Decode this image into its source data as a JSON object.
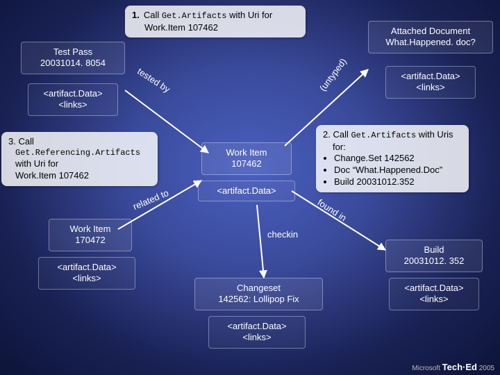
{
  "callouts": {
    "c1": {
      "num": "1.",
      "pre": "Call ",
      "code": "Get.Artifacts",
      "post": " with Uri for",
      "line2": "Work.Item 107462"
    },
    "c2": {
      "line1": "2. Call ",
      "code1": "Get.Artifacts",
      "line1b": " with Uris",
      "line2": "for:",
      "b1": "Change.Set 142562",
      "b2": "Doc “What.Happened.Doc”",
      "b3": "Build 20031012.352"
    },
    "c3": {
      "line1": "3. Call",
      "code": "Get.Referencing.Artifacts",
      "line2": "with Uri for",
      "line3": "Work.Item 107462"
    }
  },
  "nodes": {
    "testpass": {
      "l1": "Test Pass",
      "l2": "20031014. 8054"
    },
    "tp_art": {
      "l1": "<artifact.Data>",
      "l2": "<links>"
    },
    "wi107462": {
      "l1": "Work Item",
      "l2": "107462"
    },
    "wi_art": {
      "l1": "<artifact.Data>"
    },
    "doc": {
      "l1": "Attached Document",
      "l2": "What.Happened. doc?"
    },
    "doc_art": {
      "l1": "<artifact.Data>",
      "l2": "<links>"
    },
    "checkin": {
      "l1": "checkin"
    },
    "changeset": {
      "l1": "Changeset",
      "l2": "142562: Lollipop Fix"
    },
    "cs_art": {
      "l1": "<artifact.Data>",
      "l2": "<links>"
    },
    "wi170472": {
      "l1": "Work Item",
      "l2": "170472"
    },
    "wi2_art": {
      "l1": "<artifact.Data>",
      "l2": "<links>"
    },
    "build": {
      "l1": "Build",
      "l2": "20031012. 352"
    },
    "build_art": {
      "l1": "<artifact.Data>",
      "l2": "<links>"
    }
  },
  "edges": {
    "tested_by": "tested by",
    "untyped": "(untyped)",
    "related_to": "related to",
    "found_in": "found in"
  },
  "footer": {
    "brand": "Microsoft",
    "event": "Tech·Ed",
    "year": "2005"
  }
}
